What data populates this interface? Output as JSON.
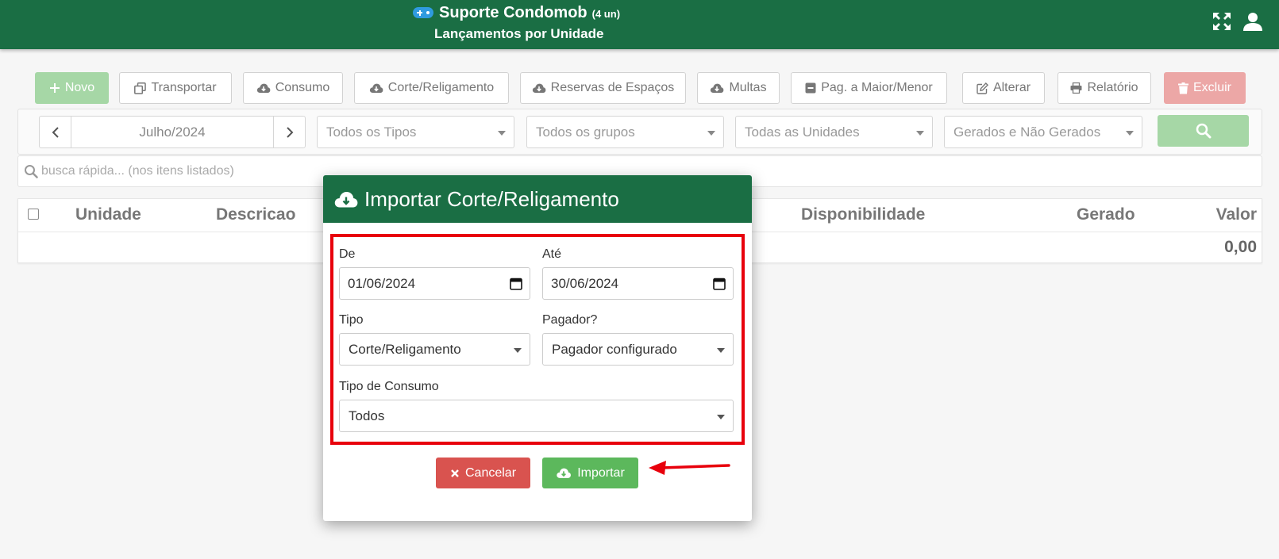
{
  "header": {
    "app_title": "Suporte Condomob",
    "unit_count": "(4 un)",
    "page_subtitle": "Lançamentos por Unidade",
    "icons": [
      "gamepad-icon",
      "expand-icon",
      "user-icon"
    ],
    "color": "#1a6e44"
  },
  "toolbar": {
    "novo": "Novo",
    "transportar": "Transportar",
    "consumo": "Consumo",
    "corte": "Corte/Religamento",
    "reservas": "Reservas de Espaços",
    "multas": "Multas",
    "pag": "Pag. a Maior/Menor",
    "alterar": "Alterar",
    "relatorio": "Relatório",
    "excluir": "Excluir"
  },
  "filters": {
    "month": "Julho/2024",
    "tipos": "Todos os Tipos",
    "grupos": "Todos os grupos",
    "unidades": "Todas as Unidades",
    "gerados": "Gerados e Não Gerados"
  },
  "quick_search": {
    "placeholder": "busca rápida... (nos itens listados)"
  },
  "table": {
    "columns": [
      "Unidade",
      "Descricao",
      "Disponibilidade",
      "Gerado",
      "Valor"
    ],
    "total": "0,00"
  },
  "modal": {
    "title": "Importar Corte/Religamento",
    "de_label": "De",
    "de_value": "01/06/2024",
    "ate_label": "Até",
    "ate_value": "30/06/2024",
    "tipo_label": "Tipo",
    "tipo_value": "Corte/Religamento",
    "pagador_label": "Pagador?",
    "pagador_value": "Pagador configurado",
    "consumo_label": "Tipo de Consumo",
    "consumo_value": "Todos",
    "cancel_label": "Cancelar",
    "import_label": "Importar",
    "highlight_color": "#e8000c"
  }
}
